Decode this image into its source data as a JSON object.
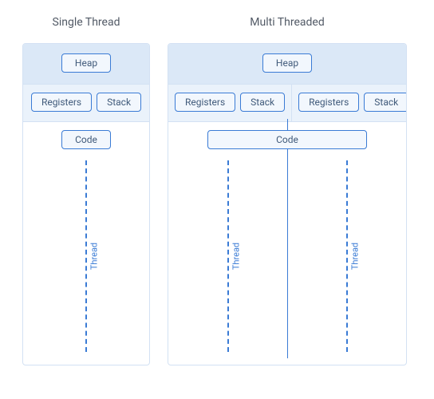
{
  "titles": {
    "single": "Single Thread",
    "multi": "Multi Threaded"
  },
  "labels": {
    "heap": "Heap",
    "registers": "Registers",
    "stack": "Stack",
    "code": "Code",
    "thread": "Thread"
  }
}
